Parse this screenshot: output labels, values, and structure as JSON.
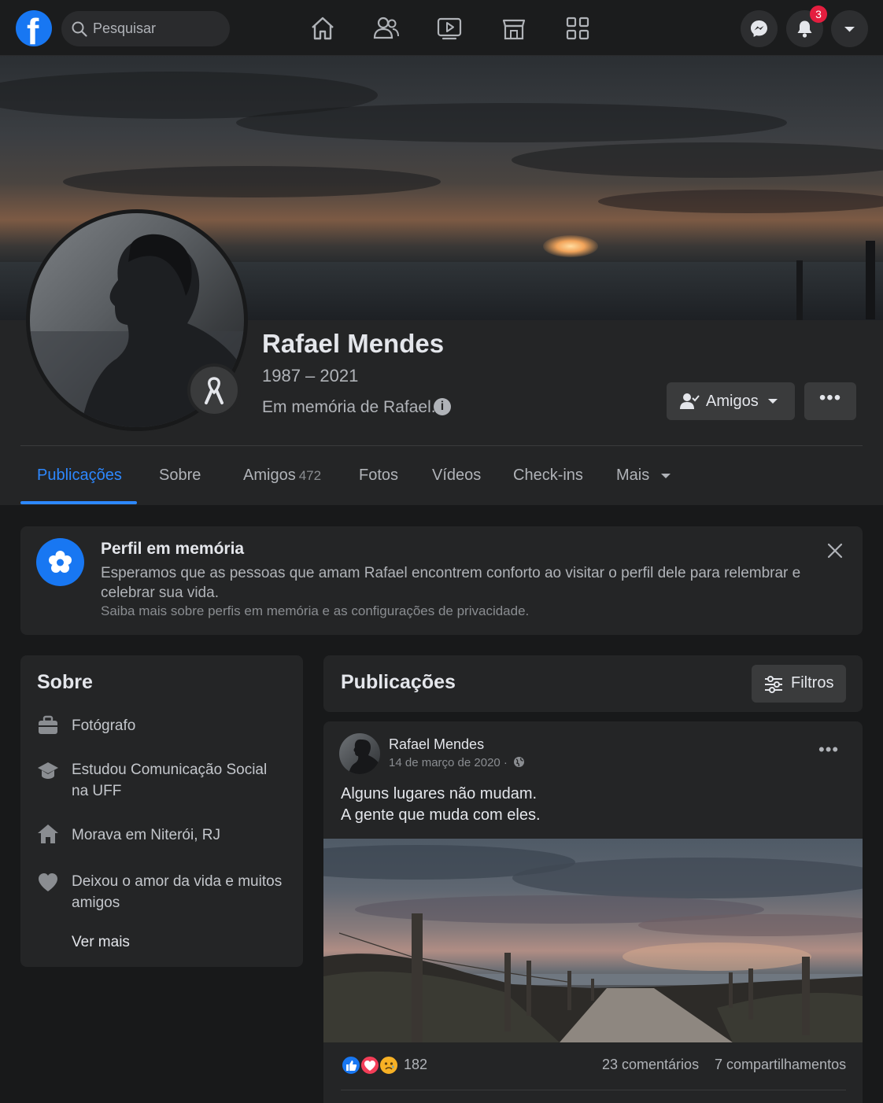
{
  "colors": {
    "page_bg": "#18191a",
    "card_bg": "#242526",
    "accent": "#2d88ff",
    "brand": "#1877f2",
    "notification_badge": "#e41e3f"
  },
  "topbar": {
    "logo_icon": "facebook-logo",
    "logo_letter": "f",
    "search_placeholder": "Pesquisar",
    "nav_icons": [
      "home-icon",
      "friends-icon",
      "watch-icon",
      "marketplace-icon",
      "menu-grid-icon"
    ],
    "notification_count": "3"
  },
  "profile": {
    "name": "Rafael Mendes",
    "years": "1987 – 2021",
    "memorial_text": "Em memória de Rafael.",
    "info_icon": "i",
    "friends_button": "Amigos",
    "more_button": "•••"
  },
  "tabs": [
    {
      "label": "Publicações",
      "count": ""
    },
    {
      "label": "Sobre",
      "count": ""
    },
    {
      "label": "Amigos",
      "count": "472"
    },
    {
      "label": "Fotos",
      "count": ""
    },
    {
      "label": "Vídeos",
      "count": ""
    },
    {
      "label": "Check-ins",
      "count": ""
    },
    {
      "label": "Mais",
      "count": ""
    }
  ],
  "memorial_notice": {
    "title": "Perfil em memória",
    "text": "Esperamos que as pessoas que amam Rafael encontrem conforto ao visitar o perfil dele para relembrar e celebrar sua vida.",
    "link": "Saiba mais sobre perfis em memória e as configurações de privacidade."
  },
  "about": {
    "title": "Sobre",
    "items": [
      {
        "icon": "briefcase-icon",
        "text": "Fotógrafo"
      },
      {
        "icon": "graduation-cap-icon",
        "text": "Estudou Comunicação Social na UFF"
      },
      {
        "icon": "house-icon",
        "text": "Morava em Niterói, RJ"
      },
      {
        "icon": "heart-icon",
        "text": "Deixou o amor da vida e muitos amigos"
      }
    ],
    "see_more": "Ver mais"
  },
  "posts": {
    "title": "Publicações",
    "filters_button": "Filtros",
    "post": {
      "author": "Rafael Mendes",
      "date": "14 de março de 2020 ·",
      "more": "•••",
      "text_line1": "Alguns lugares não mudam.",
      "text_line2": "A gente que muda com eles.",
      "reaction_count": "182",
      "comments": "23 comentários",
      "shares": "7 compartilhamentos"
    }
  }
}
